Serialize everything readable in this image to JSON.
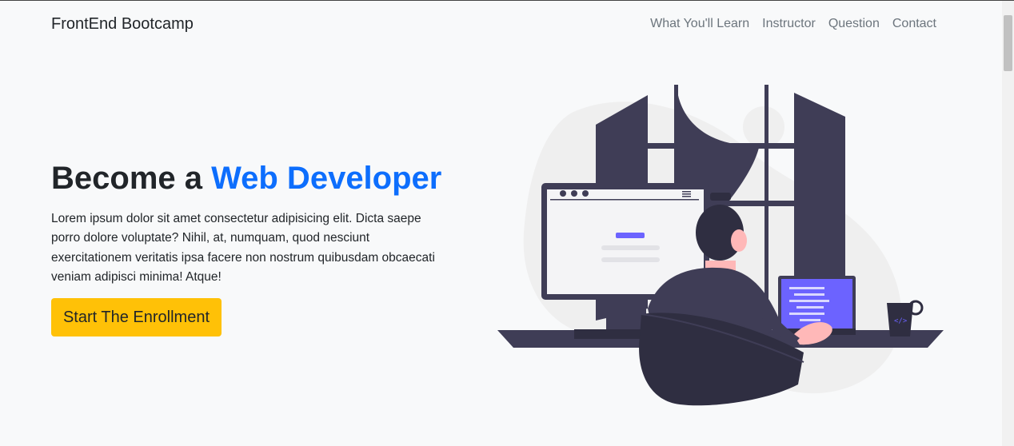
{
  "navbar": {
    "brand": "FrontEnd Bootcamp",
    "links": [
      "What You'll Learn",
      "Instructor",
      "Question",
      "Contact"
    ]
  },
  "hero": {
    "title_prefix": "Become a ",
    "title_accent": "Web Developer",
    "body": "Lorem ipsum dolor sit amet consectetur adipisicing elit. Dicta saepe porro dolore voluptate? Nihil, at, numquam, quod nesciunt exercitationem veritatis ipsa facere non nostrum quibusdam obcaecati veniam adipisci minima! Atque!",
    "cta_label": "Start The Enrollment"
  },
  "colors": {
    "accent": "#0d6efd",
    "cta": "#ffc107",
    "illustration_dark": "#3f3d56",
    "illustration_purple": "#6c63ff"
  },
  "illustration": {
    "laptop_screen_text": "</>"
  }
}
